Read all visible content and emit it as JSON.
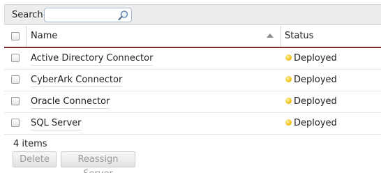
{
  "search": {
    "label": "Search:",
    "value": "",
    "placeholder": ""
  },
  "table": {
    "columns": {
      "name": "Name",
      "status": "Status"
    },
    "rows": [
      {
        "name": "Active Directory Connector",
        "status": "Deployed"
      },
      {
        "name": "CyberArk Connector",
        "status": "Deployed"
      },
      {
        "name": "Oracle Connector",
        "status": "Deployed"
      },
      {
        "name": "SQL Server",
        "status": "Deployed"
      }
    ]
  },
  "footer": {
    "items_count": "4 items",
    "delete_label": "Delete",
    "reassign_label": "Reassign Server"
  },
  "colors": {
    "header_rule": "#7d2b2b",
    "status_deployed": "#f2c21b"
  }
}
